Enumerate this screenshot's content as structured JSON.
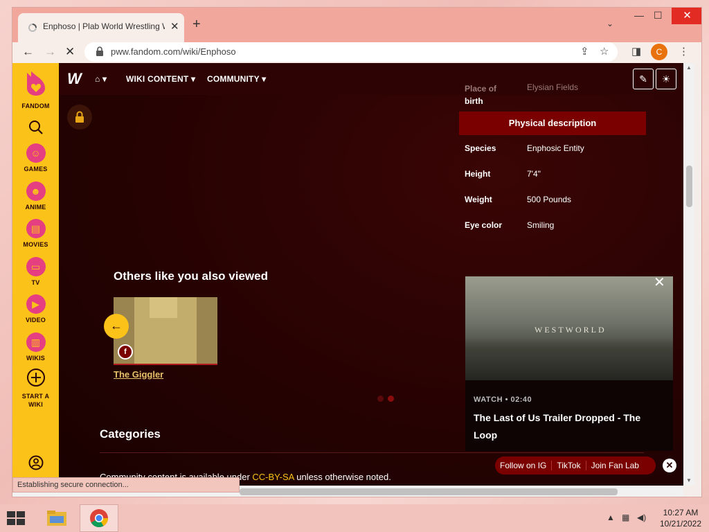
{
  "browser": {
    "tab_title": "Enphoso | Plab World Wrestling Wiki",
    "tab_close": "✕",
    "new_tab": "+",
    "tab_search": "⌄",
    "url": "pww.fandom.com/wiki/Enphoso",
    "avatar_letter": "C",
    "window_controls": {
      "minimize": "—",
      "maximize": "☐",
      "close": "✕"
    },
    "status": "Establishing secure connection..."
  },
  "rail": {
    "brand": "FANDOM",
    "items": [
      {
        "label": "GAMES"
      },
      {
        "label": "ANIME"
      },
      {
        "label": "MOVIES"
      },
      {
        "label": "TV"
      },
      {
        "label": "VIDEO"
      },
      {
        "label": "WIKIS"
      },
      {
        "label": "START A WIKI"
      }
    ]
  },
  "wiki_header": {
    "nav": [
      {
        "label": "WIKI CONTENT"
      },
      {
        "label": "COMMUNITY"
      }
    ]
  },
  "infobox": {
    "partial_label": "Place of birth",
    "partial_label_a": "Place of",
    "partial_label_b": "birth",
    "partial_value": "Elysian Fields",
    "section_title": "Physical description",
    "rows": [
      {
        "label": "Species",
        "value": "Enphosic Entity"
      },
      {
        "label": "Height",
        "value": "7'4\""
      },
      {
        "label": "Weight",
        "value": "500 Pounds"
      },
      {
        "label": "Eye color",
        "value": "Smiling"
      }
    ]
  },
  "others": {
    "title": "Others like you also viewed",
    "card_title": "The Giggler"
  },
  "categories": {
    "title": "Categories",
    "license_prefix": "Community content is available under ",
    "license_link": "CC-BY-SA",
    "license_suffix": " unless otherwise noted."
  },
  "video": {
    "overlay_text": "WESTWORLD",
    "meta": "WATCH • 02:40",
    "title": "The Last of Us Trailer Dropped - The Loop"
  },
  "follow": {
    "items": [
      "Follow on IG",
      "TikTok",
      "Join Fan Lab"
    ]
  },
  "taskbar": {
    "time": "10:27 AM",
    "date": "10/21/2022"
  },
  "colors": {
    "fandom_yellow": "#fbc21a",
    "wiki_dark": "#2a0404",
    "infobox_header": "#7a0000"
  }
}
